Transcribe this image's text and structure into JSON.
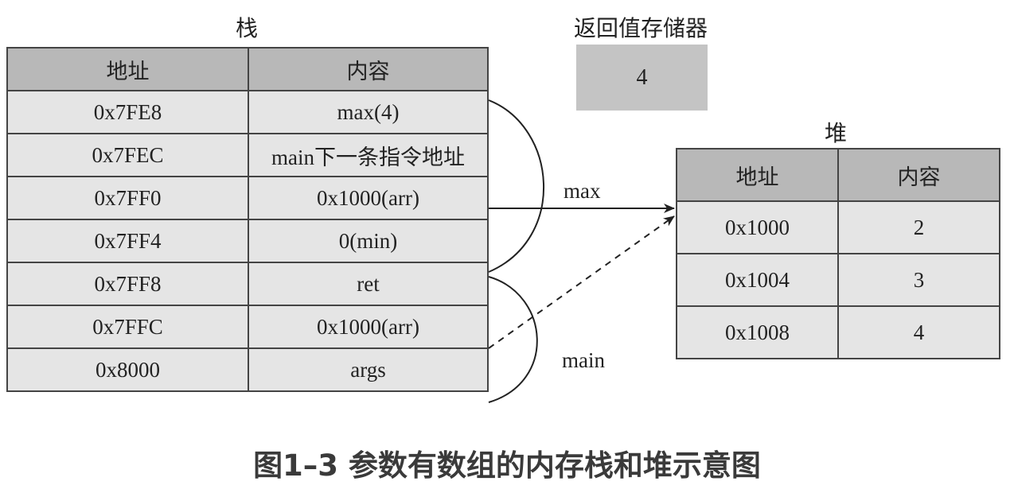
{
  "stack": {
    "title": "栈",
    "headers": [
      "地址",
      "内容"
    ],
    "rows": [
      {
        "address": "0x7FE8",
        "content": "max(4)"
      },
      {
        "address": "0x7FEC",
        "content": "main下一条指令地址"
      },
      {
        "address": "0x7FF0",
        "content": "0x1000(arr)"
      },
      {
        "address": "0x7FF4",
        "content": "0(min)"
      },
      {
        "address": "0x7FF8",
        "content": "ret"
      },
      {
        "address": "0x7FFC",
        "content": "0x1000(arr)"
      },
      {
        "address": "0x8000",
        "content": "args"
      }
    ]
  },
  "register": {
    "title": "返回值存储器",
    "value": "4"
  },
  "heap": {
    "title": "堆",
    "headers": [
      "地址",
      "内容"
    ],
    "rows": [
      {
        "address": "0x1000",
        "content": "2"
      },
      {
        "address": "0x1004",
        "content": "3"
      },
      {
        "address": "0x1008",
        "content": "4"
      }
    ]
  },
  "frames": {
    "max_label": "max",
    "main_label": "main"
  },
  "caption": "图1–3 参数有数组的内存栈和堆示意图"
}
